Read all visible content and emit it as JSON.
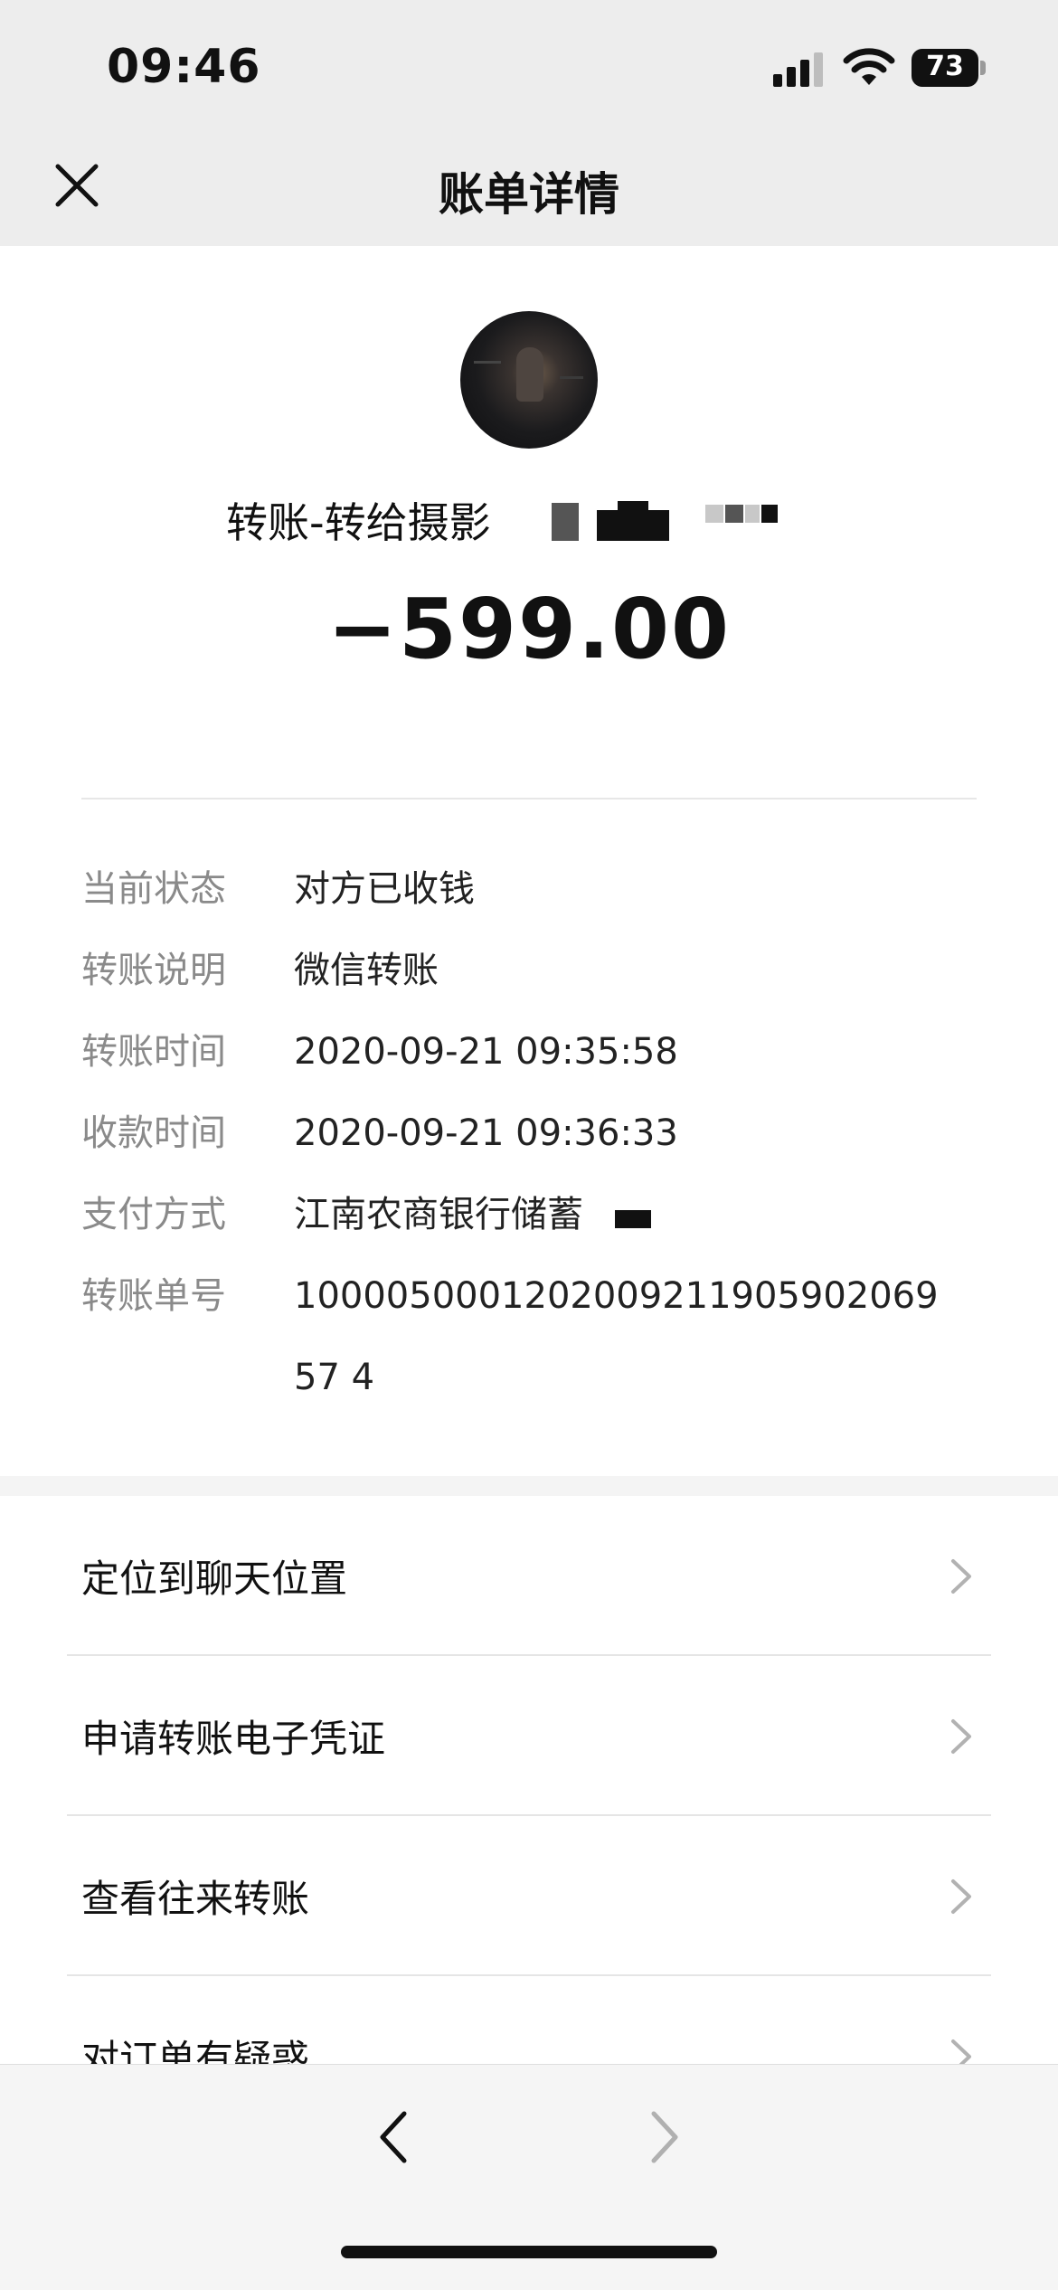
{
  "status_bar": {
    "time": "09:46",
    "battery": "73"
  },
  "nav": {
    "title": "账单详情",
    "close_icon": "close-icon"
  },
  "summary": {
    "payee": "转账-转给摄影",
    "amount": "−599.00"
  },
  "details": [
    {
      "label": "当前状态",
      "value": "对方已收钱"
    },
    {
      "label": "转账说明",
      "value": "微信转账"
    },
    {
      "label": "转账时间",
      "value": "2020-09-21 09:35:58"
    },
    {
      "label": "收款时间",
      "value": "2020-09-21 09:36:33"
    },
    {
      "label": "支付方式",
      "value": "江南农商银行储蓄"
    },
    {
      "label": "转账单号",
      "value": "100005000120200921190590206957 4"
    }
  ],
  "actions": [
    {
      "label": "定位到聊天位置",
      "icon": "chevron-right-icon"
    },
    {
      "label": "申请转账电子凭证",
      "icon": "chevron-right-icon"
    },
    {
      "label": "查看往来转账",
      "icon": "chevron-right-icon"
    },
    {
      "label": "对订单有疑惑",
      "icon": "chevron-right-icon"
    }
  ],
  "toolbar": {
    "back_icon": "chevron-left-icon",
    "forward_icon": "chevron-right-icon"
  }
}
